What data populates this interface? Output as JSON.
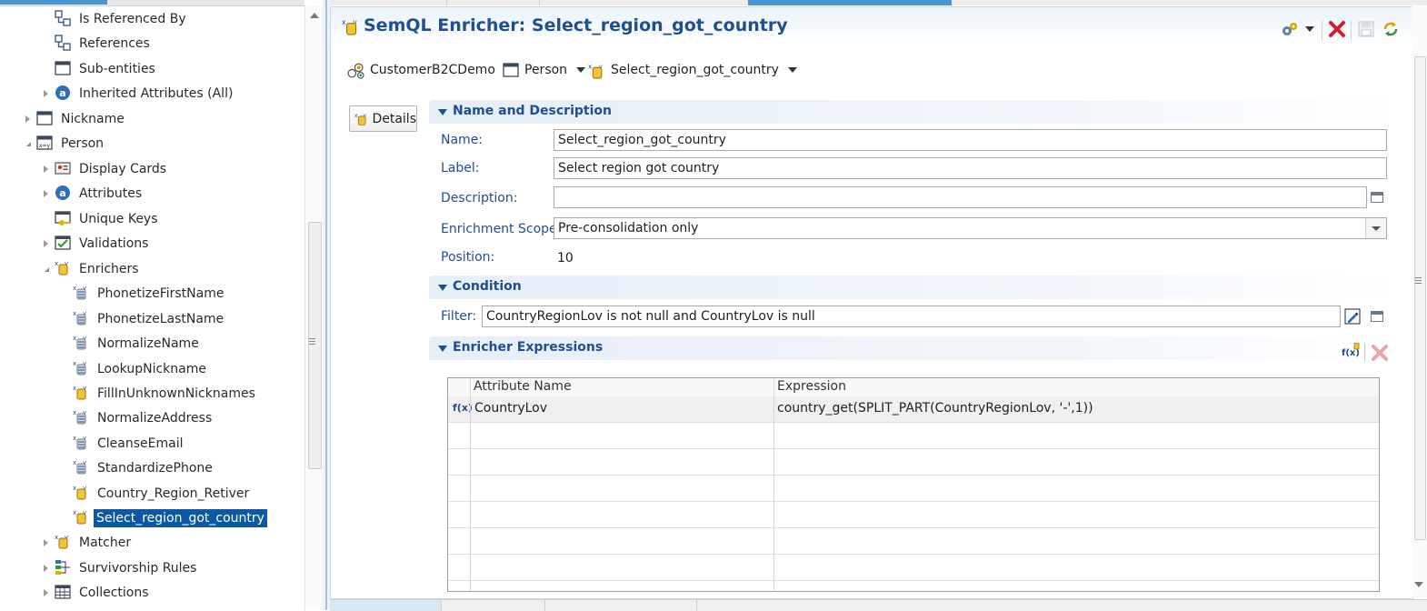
{
  "tree": {
    "items": [
      {
        "label": "Is Referenced By",
        "icon": "reference-icon"
      },
      {
        "label": "References",
        "icon": "reference-icon"
      },
      {
        "label": "Sub-entities",
        "icon": "window-icon"
      },
      {
        "label": "Inherited Attributes (All)",
        "icon": "attribute-icon"
      },
      {
        "label": "Nickname",
        "icon": "window-icon"
      },
      {
        "label": "Person",
        "icon": "entity-icon"
      },
      {
        "label": "Display Cards",
        "icon": "display-card-icon"
      },
      {
        "label": "Attributes",
        "icon": "attribute-icon"
      },
      {
        "label": "Unique Keys",
        "icon": "unique-key-icon"
      },
      {
        "label": "Validations",
        "icon": "validation-icon"
      },
      {
        "label": "Enrichers",
        "icon": "enricher-icon"
      },
      {
        "label": "PhonetizeFirstName",
        "icon": "enricher-java-icon"
      },
      {
        "label": "PhonetizeLastName",
        "icon": "enricher-java-icon"
      },
      {
        "label": "NormalizeName",
        "icon": "enricher-java-icon"
      },
      {
        "label": "LookupNickname",
        "icon": "enricher-java-icon"
      },
      {
        "label": "FillInUnknownNicknames",
        "icon": "enricher-icon"
      },
      {
        "label": "NormalizeAddress",
        "icon": "enricher-java-icon"
      },
      {
        "label": "CleanseEmail",
        "icon": "enricher-java-icon"
      },
      {
        "label": "StandardizePhone",
        "icon": "enricher-java-icon"
      },
      {
        "label": "Country_Region_Retiver",
        "icon": "enricher-icon"
      },
      {
        "label": "Select_region_got_country",
        "icon": "enricher-icon",
        "selected": true
      },
      {
        "label": "Matcher",
        "icon": "enricher-icon"
      },
      {
        "label": "Survivorship Rules",
        "icon": "survivorship-icon"
      },
      {
        "label": "Collections",
        "icon": "table-icon"
      }
    ]
  },
  "editor": {
    "title": "SemQL Enricher: Select_region_got_country",
    "breadcrumb": [
      "CustomerB2CDemo",
      "Person",
      "Select_region_got_country"
    ],
    "details_button": "Details",
    "sections": {
      "name_description": "Name and Description",
      "condition": "Condition",
      "expressions": "Enricher Expressions"
    },
    "fields": {
      "name_label": "Name:",
      "name_value": "Select_region_got_country",
      "label_label": "Label:",
      "label_value": "Select region got country",
      "description_label": "Description:",
      "description_value": "",
      "scope_label": "Enrichment Scope:",
      "scope_value": "Pre-consolidation only",
      "position_label": "Position:",
      "position_value": "10",
      "filter_label": "Filter:",
      "filter_value": "CountryRegionLov is not null and CountryLov is null"
    },
    "grid": {
      "columns": [
        "Attribute Name",
        "Expression"
      ],
      "rows": [
        {
          "marker": "f(x)",
          "attribute": "CountryLov",
          "expression": "country_get(SPLIT_PART(CountryRegionLov, '-',1))"
        }
      ]
    }
  },
  "colors": {
    "accent": "#1e4f8e",
    "selection": "#0c58a3",
    "delete_red": "#d0202a",
    "tab_active": "#4a95cf"
  }
}
